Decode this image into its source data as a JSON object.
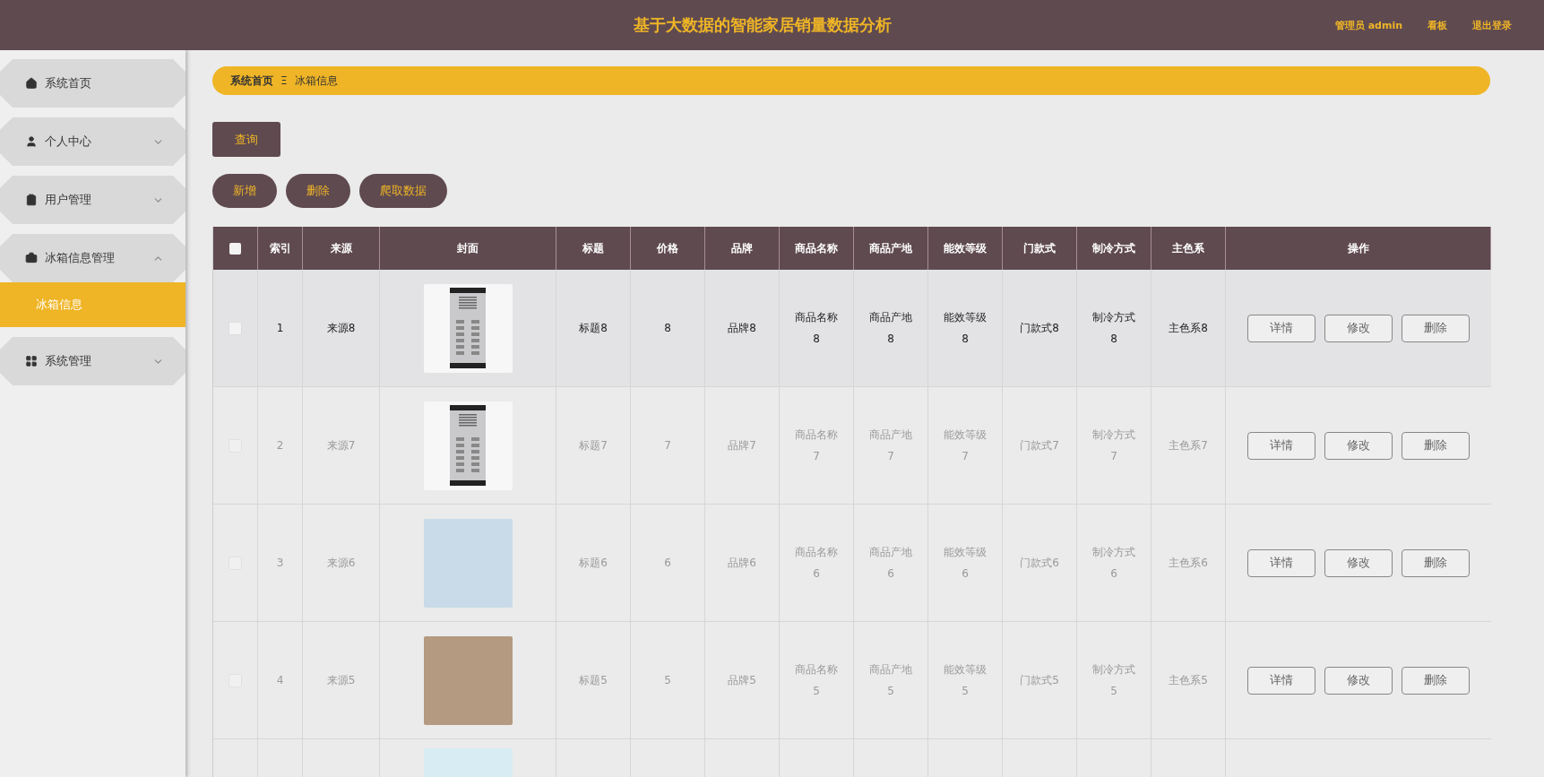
{
  "header": {
    "title": "基于大数据的智能家居销量数据分析",
    "links": [
      "管理员 admin",
      "看板",
      "退出登录"
    ]
  },
  "sidebar": {
    "items": [
      {
        "label": "系统首页"
      },
      {
        "label": "个人中心",
        "expanded": false
      },
      {
        "label": "用户管理",
        "expanded": false
      },
      {
        "label": "冰箱信息管理",
        "expanded": true,
        "children": [
          {
            "label": "冰箱信息",
            "selected": true
          }
        ]
      },
      {
        "label": "系统管理",
        "expanded": false
      }
    ]
  },
  "breadcrumb": {
    "items": [
      "系统首页",
      "冰箱信息"
    ],
    "separator": "Ξ"
  },
  "search_button": "查询",
  "actions": [
    "新增",
    "删除",
    "爬取数据"
  ],
  "table": {
    "select_all": {
      "checked": false
    },
    "columns": [
      "索引",
      "来源",
      "封面",
      "标题",
      "价格",
      "品牌",
      "商品名称",
      "商品产地",
      "能效等级",
      "门款式",
      "制冷方式",
      "主色系",
      "操作"
    ],
    "rows": [
      {
        "highlighted": true,
        "checked": false,
        "cells": [
          "1",
          "来源8",
          "",
          "标题8",
          "8",
          "品牌8",
          "商品名称8",
          "商品产地8",
          "能效等级8",
          "门款式8",
          "制冷方式8",
          "主色系8"
        ],
        "actions": [
          "详情",
          "修改",
          "删除"
        ]
      },
      {
        "highlighted": false,
        "checked": false,
        "cells": [
          "2",
          "来源7",
          "",
          "标题7",
          "7",
          "品牌7",
          "商品名称7",
          "商品产地7",
          "能效等级7",
          "门款式7",
          "制冷方式7",
          "主色系7"
        ],
        "actions": [
          "详情",
          "修改",
          "删除"
        ]
      },
      {
        "highlighted": false,
        "checked": false,
        "cells": [
          "3",
          "来源6",
          "",
          "标题6",
          "6",
          "品牌6",
          "商品名称6",
          "商品产地6",
          "能效等级6",
          "门款式6",
          "制冷方式6",
          "主色系6"
        ],
        "actions": [
          "详情",
          "修改",
          "删除"
        ]
      },
      {
        "highlighted": false,
        "checked": false,
        "cells": [
          "4",
          "来源5",
          "",
          "标题5",
          "5",
          "品牌5",
          "商品名称5",
          "商品产地5",
          "能效等级5",
          "门款式5",
          "制冷方式5",
          "主色系5"
        ],
        "actions": [
          "详情",
          "修改",
          "删除"
        ]
      },
      {
        "cells": [],
        "actions": []
      }
    ]
  }
}
